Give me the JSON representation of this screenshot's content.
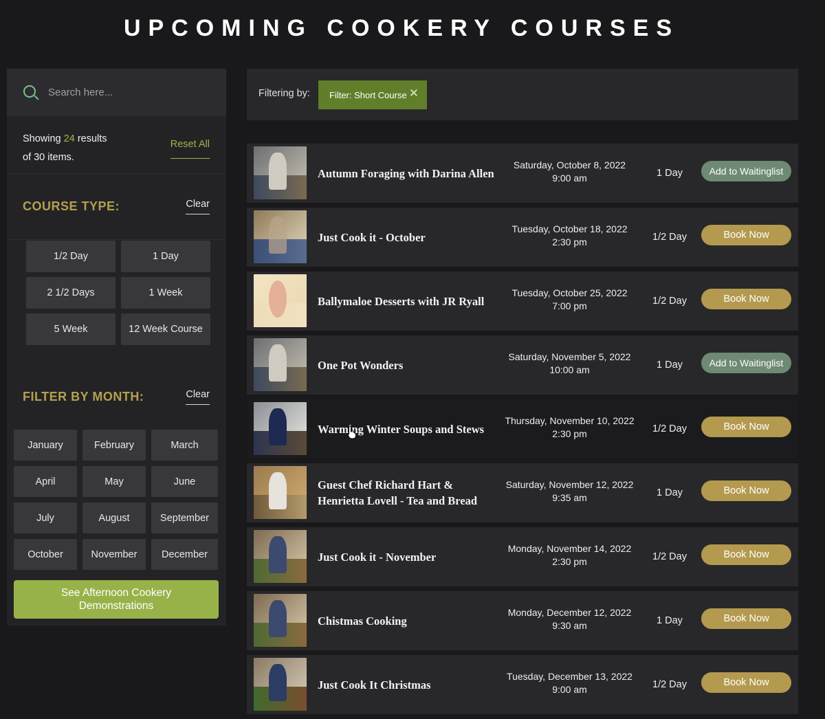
{
  "page": {
    "title": "UPCOMING COOKERY COURSES"
  },
  "search": {
    "placeholder": "Search here...",
    "icon": "search-icon"
  },
  "results": {
    "prefix": "Showing",
    "count": "24",
    "middle": "results",
    "suffix": "of 30 items.",
    "reset_label": "Reset All"
  },
  "course_type": {
    "title": "COURSE TYPE:",
    "clear_label": "Clear",
    "options": [
      "1/2 Day",
      "1 Day",
      "2 1/2 Days",
      "1 Week",
      "5 Week",
      "12 Week Course"
    ]
  },
  "month_filter": {
    "title": "FILTER BY MONTH:",
    "clear_label": "Clear",
    "months": [
      "January",
      "February",
      "March",
      "April",
      "May",
      "June",
      "July",
      "August",
      "September",
      "October",
      "November",
      "December"
    ]
  },
  "demo_button": {
    "label": "See Afternoon Cookery Demonstrations"
  },
  "filter_bar": {
    "label": "Filtering by:",
    "tag": "Filter: Short Course"
  },
  "colors": {
    "accent_green": "#98b24a",
    "gold": "#b39a4f",
    "waitlist": "#6e8a72",
    "background": "#19191b"
  },
  "courses": [
    {
      "name": "Autumn Foraging with Darina Allen",
      "date": "Saturday, October 8, 2022",
      "time": "9:00 am",
      "length": "1 Day",
      "action": "Add to Waitinglist"
    },
    {
      "name": "Just Cook it - October",
      "date": "Tuesday, October 18, 2022",
      "time": "2:30 pm",
      "length": "1/2 Day",
      "action": "Book Now"
    },
    {
      "name": "Ballymaloe Desserts with JR Ryall",
      "date": "Tuesday, October 25, 2022",
      "time": "7:00 pm",
      "length": "1/2 Day",
      "action": "Book Now"
    },
    {
      "name": "One Pot Wonders",
      "date": "Saturday, November 5, 2022",
      "time": "10:00 am",
      "length": "1 Day",
      "action": "Add to Waitinglist"
    },
    {
      "name": "Warming Winter Soups and Stews",
      "date": "Thursday, November 10, 2022",
      "time": "2:30 pm",
      "length": "1/2 Day",
      "action": "Book Now"
    },
    {
      "name": "Guest Chef Richard Hart & Henrietta Lovell - Tea and Bread",
      "date": "Saturday, November 12, 2022",
      "time": "9:35 am",
      "length": "1 Day",
      "action": "Book Now"
    },
    {
      "name": "Just Cook it - November",
      "date": "Monday, November 14, 2022",
      "time": "2:30 pm",
      "length": "1/2 Day",
      "action": "Book Now"
    },
    {
      "name": "Chistmas Cooking",
      "date": "Monday, December 12, 2022",
      "time": "9:30 am",
      "length": "1 Day",
      "action": "Book Now"
    },
    {
      "name": "Just Cook It Christmas",
      "date": "Tuesday, December 13, 2022",
      "time": "9:00 am",
      "length": "1/2 Day",
      "action": "Book Now"
    }
  ]
}
